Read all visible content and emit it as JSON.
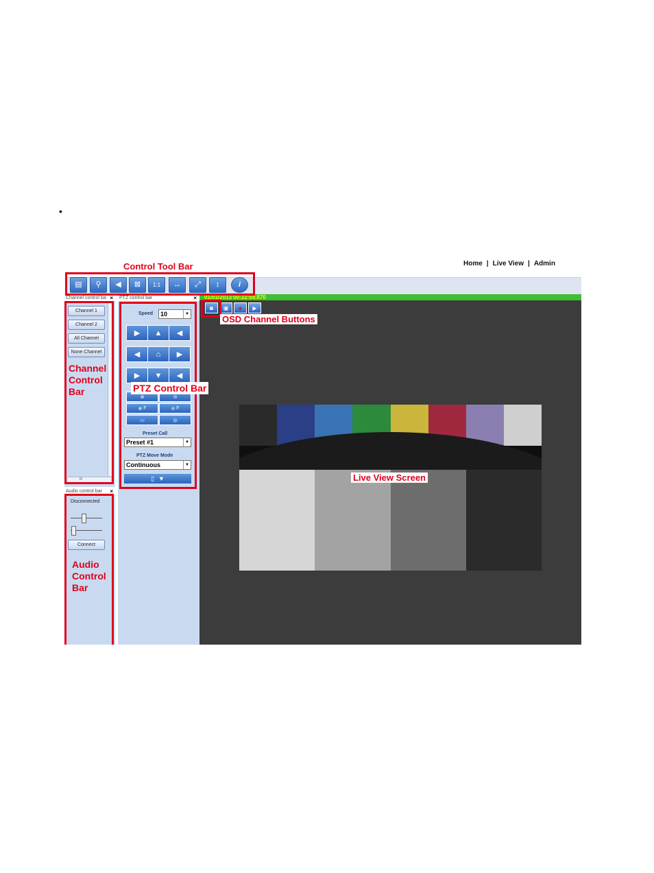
{
  "bullet": "•",
  "nav": {
    "home": "Home",
    "sep": "|",
    "live_view": "Live View",
    "admin": "Admin"
  },
  "timestamp": "01/01/2013 00:22:59.870",
  "channel_panel": {
    "title": "Channel control ba",
    "close": "×",
    "buttons": [
      "Channel 1",
      "Channel 2",
      "All Channel",
      "None Channel"
    ],
    "hscroll_thumb": "III"
  },
  "ptz_panel": {
    "title": "PTZ control bar",
    "close": "×",
    "speed_label": "Speed",
    "speed_value": "10",
    "preset_call_label": "Preset Call",
    "preset_value": "Preset #1",
    "move_mode_label": "PTZ Move Mode",
    "move_mode_value": "Continuous",
    "zoom_in_label": "F",
    "zoom_out_label": "F"
  },
  "audio_panel": {
    "title": "Audio control bar",
    "close": "×",
    "status": "Disconnected",
    "connect_label": "Connect"
  },
  "annotations": {
    "control_tool_bar": "Control Tool Bar",
    "osd_channel_buttons": "OSD Channel Buttons",
    "channel_control_bar": "Channel Control Bar",
    "ptz_control_bar": "PTZ Control Bar",
    "live_view_screen": "Live View Screen",
    "audio_control_bar": "Audio Control Bar"
  },
  "colors": {
    "annotation": "#e0001b",
    "status_bar": "#3fbf33",
    "live_background": "#3c3c3c",
    "panel": "#c9daf0"
  },
  "icons": {
    "toolbar": [
      "layout-icon",
      "network-icon",
      "speaker-icon",
      "fullscreen-icon",
      "one-to-one-icon",
      "fit-width-icon",
      "expand-icon",
      "fit-height-icon",
      "info-icon"
    ],
    "osd": [
      "snapshot-icon",
      "image-icon",
      "record-icon",
      "play-icon"
    ]
  }
}
